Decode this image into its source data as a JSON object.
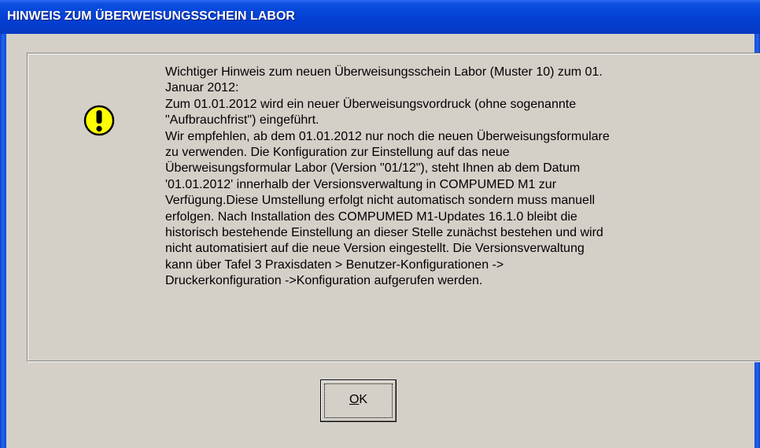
{
  "window": {
    "title": "HINWEIS ZUM ÜBERWEISUNGSSCHEIN LABOR"
  },
  "icon": {
    "name": "warning-exclamation-icon",
    "color": "#ffff00"
  },
  "message": {
    "lines": [
      "Wichtiger Hinweis zum neuen Überweisungsschein Labor (Muster 10) zum 01.",
      "Januar 2012:",
      "Zum 01.01.2012 wird ein neuer Überweisungsvordruck (ohne sogenannte",
      "\"Aufbrauchfrist\") eingeführt.",
      "Wir empfehlen, ab dem 01.01.2012 nur noch die neuen Überweisungsformulare",
      "zu verwenden. Die Konfiguration zur Einstellung auf das neue",
      "Überweisungsformular Labor (Version \"01/12\"), steht Ihnen ab dem Datum",
      "'01.01.2012' innerhalb der Versionsverwaltung in COMPUMED M1 zur",
      "Verfügung.Diese Umstellung erfolgt nicht automatisch sondern muss manuell",
      "erfolgen. Nach Installation des COMPUMED M1-Updates 16.1.0 bleibt die",
      "historisch bestehende Einstellung an dieser Stelle zunächst bestehen und wird",
      "nicht automatisiert auf die neue Version eingestellt. Die Versionsverwaltung",
      "kann über  Tafel 3 Praxisdaten > Benutzer-Konfigurationen ->",
      "Druckerkonfiguration ->Konfiguration aufgerufen werden."
    ]
  },
  "buttons": {
    "ok": {
      "mnemonic": "O",
      "rest": "K"
    }
  }
}
